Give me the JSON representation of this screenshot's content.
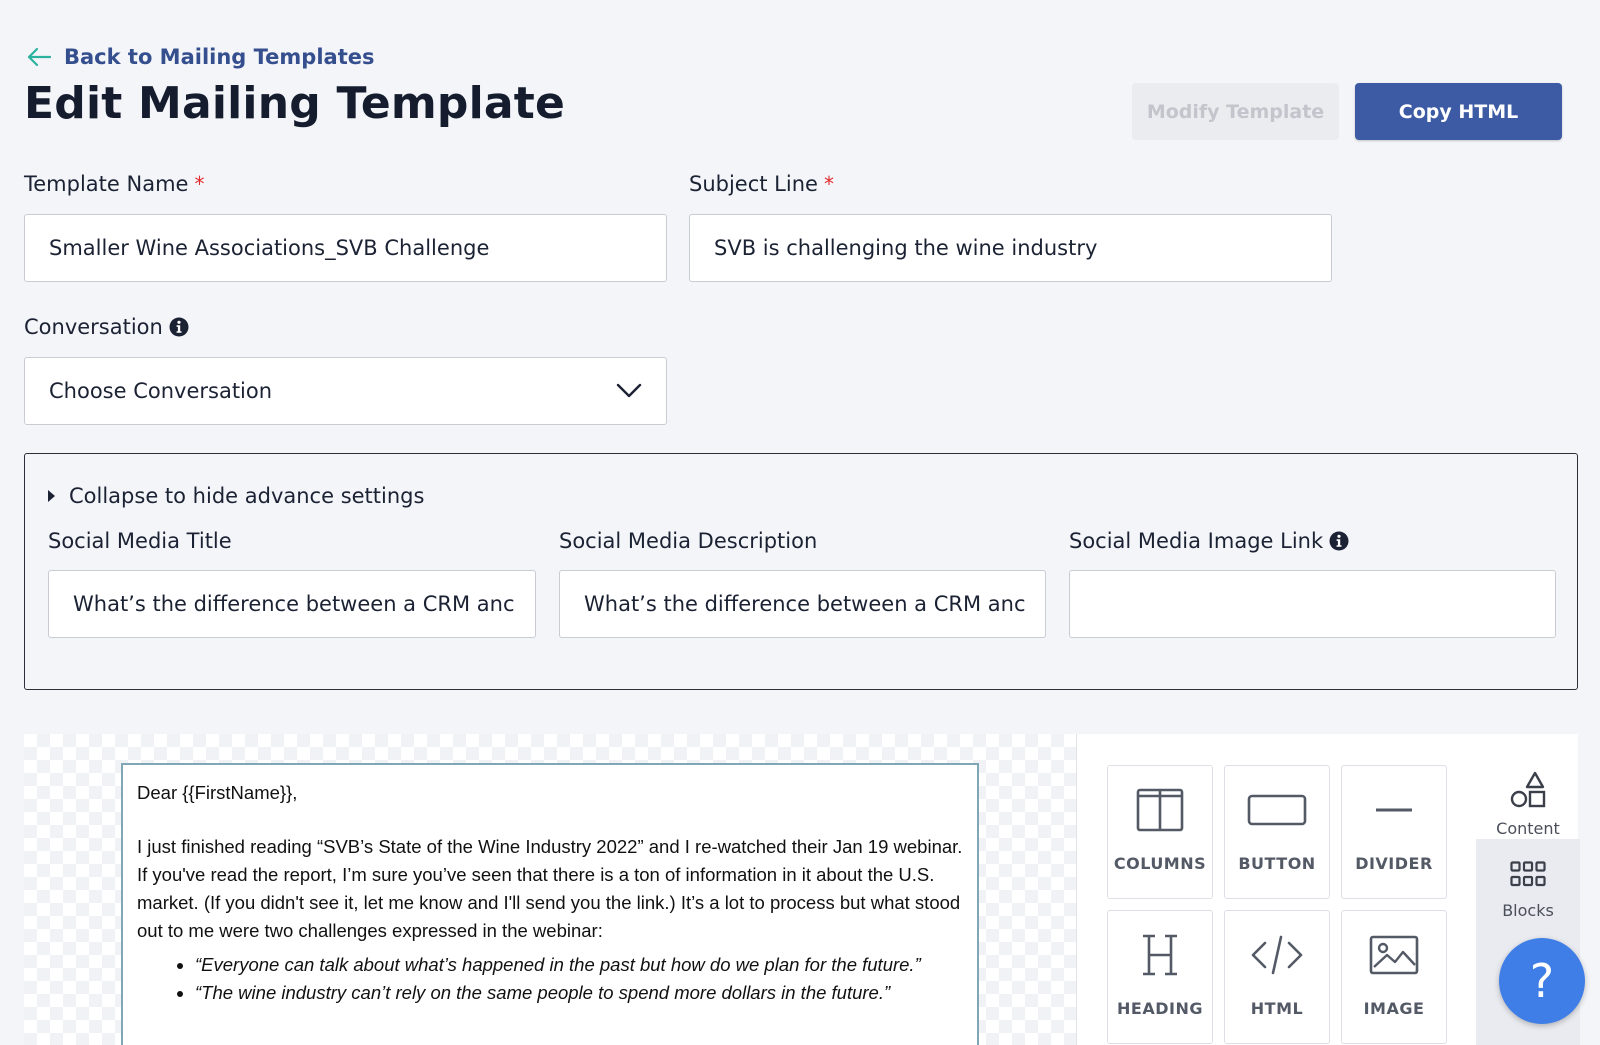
{
  "header": {
    "back_label": "Back to Mailing Templates",
    "page_title": "Edit Mailing Template",
    "modify_label": "Modify Template",
    "copy_label": "Copy HTML"
  },
  "form": {
    "template_name": {
      "label": "Template Name",
      "required_mark": "*",
      "value": "Smaller Wine Associations_SVB Challenge"
    },
    "subject_line": {
      "label": "Subject Line",
      "required_mark": "*",
      "value": "SVB is challenging the wine industry"
    },
    "conversation": {
      "label": "Conversation",
      "selected": "Choose Conversation"
    }
  },
  "advanced": {
    "toggle_label": "Collapse to hide advance settings",
    "social_title": {
      "label": "Social Media Title",
      "value": "What’s the difference between a CRM anc"
    },
    "social_description": {
      "label": "Social Media Description",
      "value": "What’s the difference between a CRM anc"
    },
    "social_image": {
      "label": "Social Media Image Link",
      "value": ""
    }
  },
  "email": {
    "greeting": "Dear {{FirstName}},",
    "paragraph": "I just finished reading “SVB’s State of the Wine Industry 2022” and I re-watched their Jan 19 webinar. If you've read the report, I’m sure you’ve seen that there is a ton of information in it about the U.S. market. (If you didn't see it, let me know and I'll send you the link.) It’s a lot to process but what stood out to me were two challenges expressed in the webinar:",
    "bullets": [
      "“Everyone can talk about what’s happened in the past but how do we plan for the future.”",
      "“The wine industry can’t rely on the same people to spend more dollars in the future.”"
    ]
  },
  "tools": {
    "items": [
      {
        "label": "COLUMNS",
        "icon": "columns-icon"
      },
      {
        "label": "BUTTON",
        "icon": "button-icon"
      },
      {
        "label": "DIVIDER",
        "icon": "divider-icon"
      },
      {
        "label": "HEADING",
        "icon": "heading-icon"
      },
      {
        "label": "HTML",
        "icon": "html-code-icon"
      },
      {
        "label": "IMAGE",
        "icon": "image-icon"
      }
    ],
    "tabs": [
      {
        "label": "Content",
        "icon": "shapes-icon"
      },
      {
        "label": "Blocks",
        "icon": "grid-icon"
      }
    ]
  },
  "help": {
    "label": "?"
  },
  "colors": {
    "primary": "#3d5ba4",
    "link": "#344e8e",
    "required": "#e32b2b",
    "help": "#3f7ee6"
  }
}
